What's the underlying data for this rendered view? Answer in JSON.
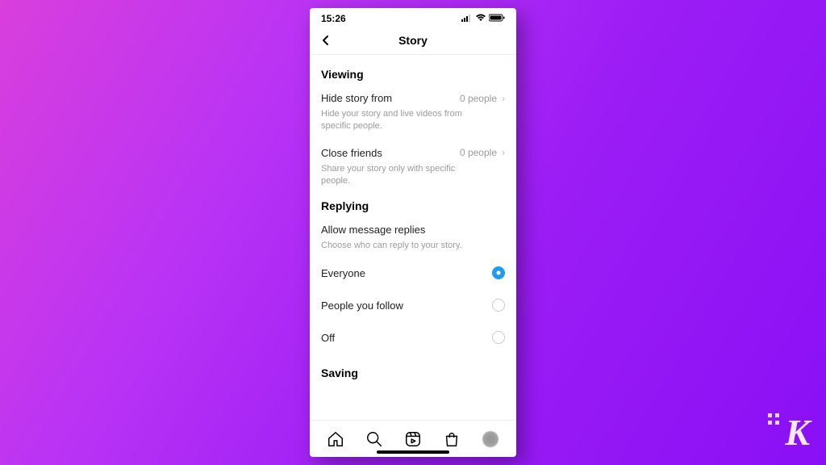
{
  "status_bar": {
    "time": "15:26"
  },
  "header": {
    "title": "Story"
  },
  "viewing": {
    "title": "Viewing",
    "hide_story": {
      "label": "Hide story from",
      "value": "0 people",
      "desc": "Hide your story and live videos from specific people."
    },
    "close_friends": {
      "label": "Close friends",
      "value": "0 people",
      "desc": "Share your story only with specific people."
    }
  },
  "replying": {
    "title": "Replying",
    "allow_replies": {
      "label": "Allow message replies",
      "desc": "Choose who can reply to your story."
    },
    "options": {
      "everyone": "Everyone",
      "people_you_follow": "People you follow",
      "off": "Off"
    },
    "selected": "everyone"
  },
  "saving": {
    "title": "Saving"
  },
  "watermark": "K"
}
